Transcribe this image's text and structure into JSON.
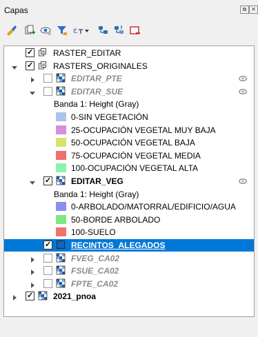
{
  "panel": {
    "title": "Capas",
    "float_glyph": "⧉",
    "close_glyph": "✕"
  },
  "toolbar": {
    "buttons": [
      {
        "icon": "style-brush-icon"
      },
      {
        "icon": "add-group-icon"
      },
      {
        "icon": "manage-visibility-icon"
      },
      {
        "icon": "filter-legend-icon"
      },
      {
        "icon": "filter-expression-icon"
      },
      {
        "icon": "dropdown-arrow-icon"
      },
      {
        "icon": "expand-all-icon"
      },
      {
        "icon": "collapse-all-icon"
      },
      {
        "icon": "remove-layer-icon"
      }
    ]
  },
  "colors": {
    "selection": "#0078d7",
    "label_muted": "#8c8c8c",
    "accent_icon": "#1f5fae"
  },
  "layers": [
    {
      "kind": "group",
      "label": "RASTER_EDITAR",
      "checked": true,
      "expander": "none",
      "level": 0,
      "icon": "group-icon",
      "style": "normal"
    },
    {
      "kind": "group",
      "label": "RASTERS_ORIGINALES",
      "checked": true,
      "expander": "open",
      "level": 0,
      "icon": "group-icon",
      "style": "normal"
    },
    {
      "kind": "layer",
      "label": "EDITAR_PTE",
      "checked": false,
      "expander": "closed",
      "level": 1,
      "icon": "raster-layer-icon",
      "style": "muted",
      "linked": true
    },
    {
      "kind": "layer",
      "label": "EDITAR_SUE",
      "checked": false,
      "expander": "open",
      "level": 1,
      "icon": "raster-layer-icon",
      "style": "muted",
      "linked": true
    },
    {
      "kind": "legend-title",
      "label": "Banda 1: Height (Gray)",
      "level": 2
    },
    {
      "kind": "legend",
      "label": "0-SIN VEGETACIÓN",
      "color": "#a9c4e6",
      "level": 2
    },
    {
      "kind": "legend",
      "label": "25-OCUPACIÓN VEGETAL MUY BAJA",
      "color": "#d58ee0",
      "level": 2
    },
    {
      "kind": "legend",
      "label": "50-OCUPACIÓN VEGETAL BAJA",
      "color": "#d6e46a",
      "level": 2
    },
    {
      "kind": "legend",
      "label": "75-OCUPACIÓN VEGETAL MEDIA",
      "color": "#ee6e72",
      "level": 2
    },
    {
      "kind": "legend",
      "label": "100-OCUPACIÓN VEGETAL ALTA",
      "color": "#8ef2ae",
      "level": 2
    },
    {
      "kind": "layer",
      "label": "EDITAR_VEG",
      "checked": true,
      "expander": "open",
      "level": 1,
      "icon": "raster-layer-icon",
      "style": "bold",
      "linked": true
    },
    {
      "kind": "legend-title",
      "label": "Banda 1: Height (Gray)",
      "level": 2
    },
    {
      "kind": "legend",
      "label": "0-ARBOLADO/MATORRAL/EDIFICIO/AGUA",
      "color": "#8c8cf2",
      "level": 2
    },
    {
      "kind": "legend",
      "label": "50-BORDE ARBOLADO",
      "color": "#7ee884",
      "level": 2
    },
    {
      "kind": "legend",
      "label": "100-SUELO",
      "color": "#ef7470",
      "level": 2
    },
    {
      "kind": "layer",
      "label": "RECINTOS_ALEGADOS",
      "checked": true,
      "expander": "none",
      "level": 1,
      "icon": "polygon-layer-icon",
      "style": "selected",
      "selected": true
    },
    {
      "kind": "layer",
      "label": "FVEG_CA02",
      "checked": false,
      "expander": "closed",
      "level": 1,
      "icon": "raster-layer-icon",
      "style": "muted"
    },
    {
      "kind": "layer",
      "label": "FSUE_CA02",
      "checked": false,
      "expander": "closed",
      "level": 1,
      "icon": "raster-layer-icon",
      "style": "muted"
    },
    {
      "kind": "layer",
      "label": "FPTE_CA02",
      "checked": false,
      "expander": "closed",
      "level": 1,
      "icon": "raster-layer-icon",
      "style": "muted"
    },
    {
      "kind": "layer",
      "label": "2021_pnoa",
      "checked": true,
      "expander": "closed",
      "level": 0,
      "icon": "raster-layer-icon",
      "style": "bold"
    }
  ]
}
